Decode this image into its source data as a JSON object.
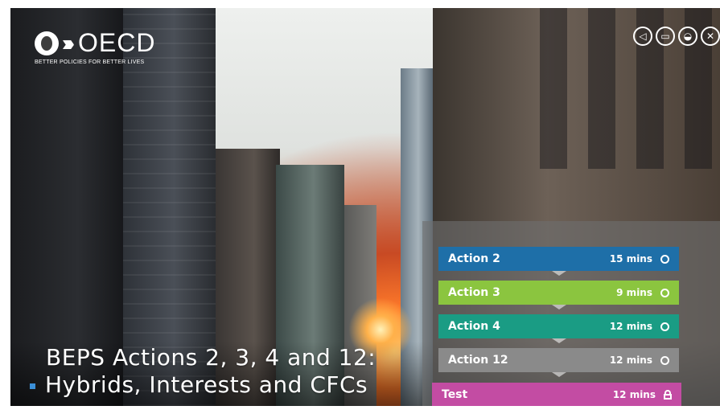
{
  "logo": {
    "name": "OECD",
    "tagline": "BETTER POLICIES FOR BETTER LIVES"
  },
  "controls": [
    {
      "icon": "audio-icon",
      "glyph": "◁"
    },
    {
      "icon": "notes-icon",
      "glyph": "▭"
    },
    {
      "icon": "folder-icon",
      "glyph": "◒"
    },
    {
      "icon": "close-icon",
      "glyph": "✕"
    }
  ],
  "title": {
    "line1": "BEPS Actions 2, 3, 4 and 12:",
    "line2": "Hybrids, Interests and CFCs"
  },
  "modules": [
    {
      "label": "Action 2",
      "time": "15 mins",
      "status": "circle",
      "color": "#1e6fa8"
    },
    {
      "label": "Action 3",
      "time": "9 mins",
      "status": "circle",
      "color": "#8bc53f"
    },
    {
      "label": "Action 4",
      "time": "12 mins",
      "status": "circle",
      "color": "#1a9c84"
    },
    {
      "label": "Action 12",
      "time": "12 mins",
      "status": "circle",
      "color": "#8a8a8a"
    },
    {
      "label": "Test",
      "time": "12 mins",
      "status": "locked",
      "color": "#c34ca3"
    }
  ]
}
